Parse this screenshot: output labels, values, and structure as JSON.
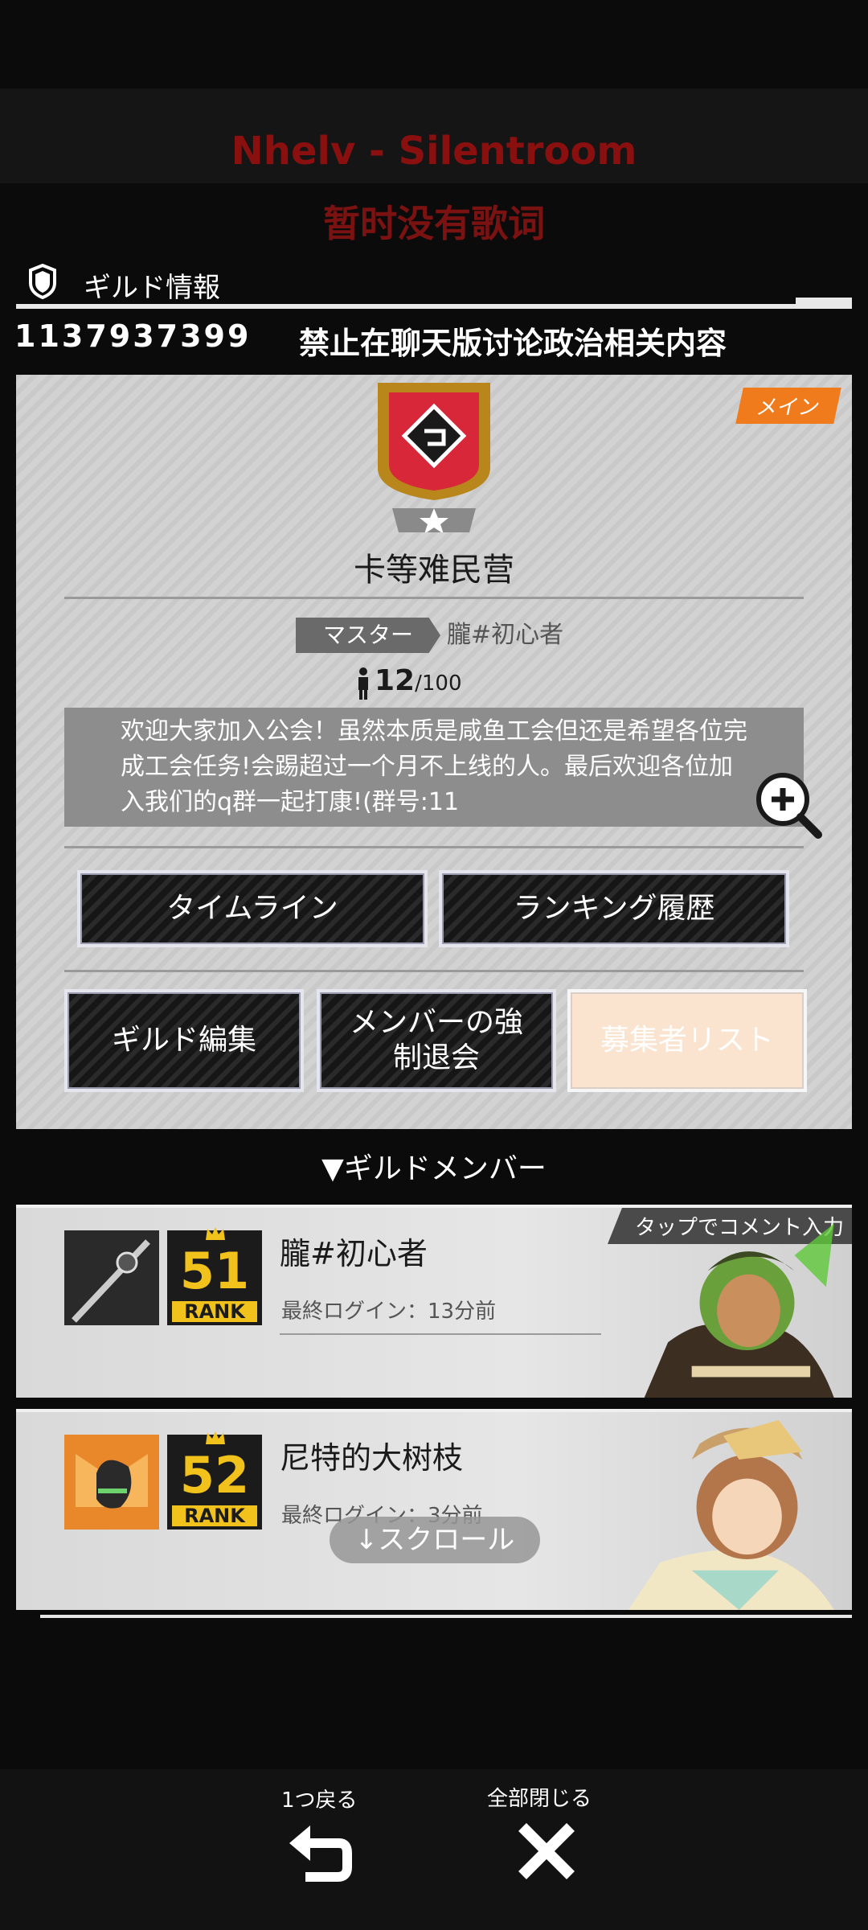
{
  "lyrics": {
    "title": "Nhelv - Silentroom",
    "subtitle": "暂时没有歌词"
  },
  "header": {
    "title": "ギルド情報",
    "qq_number": "1137937399",
    "notice": "禁止在聊天版讨论政治相关内容"
  },
  "guild": {
    "tag": "メイン",
    "name": "卡等难民营",
    "master_label": "マスター",
    "master_name": "朧#初心者",
    "member_count": "12",
    "member_max": "/100",
    "description": "欢迎大家加入公会！虽然本质是咸鱼工会但还是希望各位完成工会任务!会踢超过一个月不上线的人。最后欢迎各位加入我们的q群一起打康!(群号:11",
    "buttons": {
      "timeline": "タイムライン",
      "ranking": "ランキング履歴",
      "edit": "ギルド編集",
      "kick": "メンバーの強制退会",
      "applicants": "募集者リスト"
    }
  },
  "members_section": {
    "title": "▼ギルドメンバー",
    "tap_hint": "タップでコメント入力",
    "rank_label": "RANK",
    "members": [
      {
        "name": "朧#初心者",
        "rank": "51",
        "last_login": "最終ログイン：13分前"
      },
      {
        "name": "尼特的大树枝",
        "rank": "52",
        "last_login": "最終ログイン：3分前"
      }
    ]
  },
  "scroll_hint": "↓スクロール",
  "footer": {
    "back_label": "1つ戻る",
    "close_label": "全部閉じる"
  },
  "colors": {
    "accent": "#f07b1c",
    "emblem": "#d9273a",
    "rank_gold": "#f1c21b"
  }
}
